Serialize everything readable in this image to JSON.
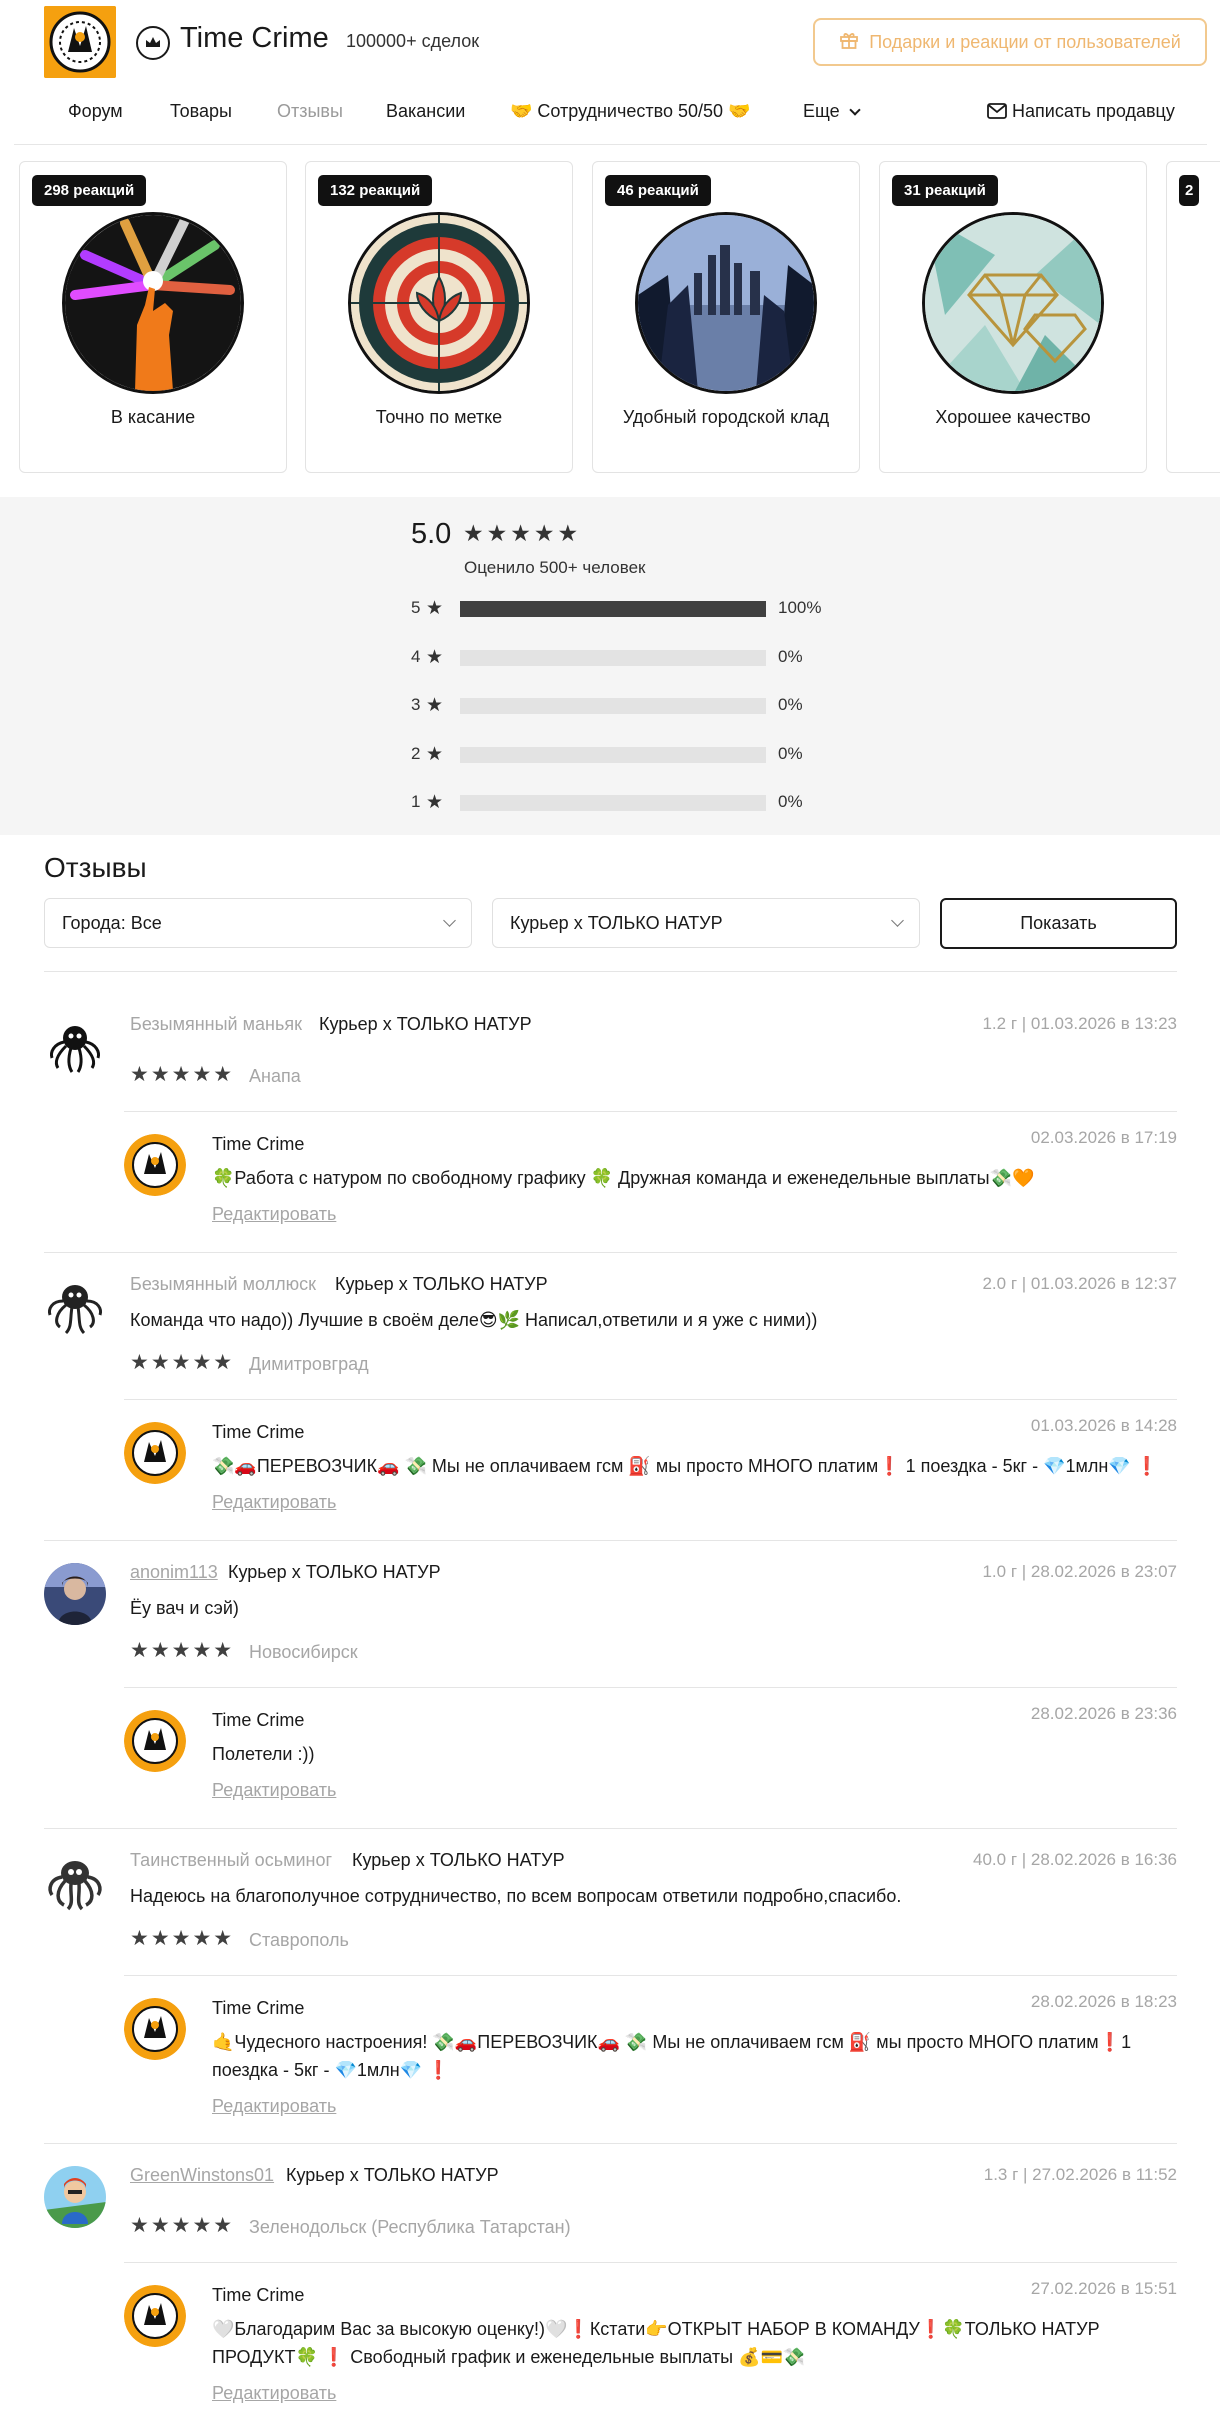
{
  "header": {
    "shop_title": "Time Crime",
    "deals": "100000+ сделок",
    "gifts_button": "Подарки и реакции от пользователей"
  },
  "nav": {
    "items": [
      "Форум",
      "Товары",
      "Отзывы",
      "Вакансии",
      "🤝 Сотрудничество 50/50 🤝",
      "Еще"
    ],
    "write_seller": "Написать продавцу"
  },
  "gift_cards": [
    {
      "badge": "298 реакций",
      "label": "В касание"
    },
    {
      "badge": "132 реакций",
      "label": "Точно по метке"
    },
    {
      "badge": "46 реакций",
      "label": "Удобный городской клад"
    },
    {
      "badge": "31 реакций",
      "label": "Хорошее качество"
    },
    {
      "badge": "2",
      "label": ""
    }
  ],
  "rating": {
    "average": "5.0",
    "stars": "★★★★★",
    "rated_by": "Оценило 500+ человек",
    "rows": [
      {
        "stars": "5",
        "percent_label": "100%",
        "fraction": 1.0
      },
      {
        "stars": "4",
        "percent_label": "0%",
        "fraction": 0
      },
      {
        "stars": "3",
        "percent_label": "0%",
        "fraction": 0
      },
      {
        "stars": "2",
        "percent_label": "0%",
        "fraction": 0
      },
      {
        "stars": "1",
        "percent_label": "0%",
        "fraction": 0
      }
    ]
  },
  "reviews_section": {
    "title": "Отзывы",
    "city_filter": "Города: Все",
    "product_filter": "Курьер x ТОЛЬКО НАТУР",
    "show_button": "Показать"
  },
  "reviews": [
    {
      "author": "Безымянный маньяк",
      "product": "Курьер x ТОЛЬКО НАТУР",
      "date": "1.2 г | 01.03.2026 в 13:23",
      "text": "",
      "stars": "★★★★★",
      "city": "Анапа",
      "reply": {
        "seller": "Time Crime",
        "date": "02.03.2026 в 17:19",
        "text": "🍀Работа с натуром по свободному графику 🍀 Дружная команда и еженедельные выплаты💸🧡",
        "edit": "Редактировать"
      }
    },
    {
      "author": "Безымянный моллюск",
      "product": "Курьер x ТОЛЬКО НАТУР",
      "date": "2.0 г | 01.03.2026 в 12:37",
      "text": "Команда что надо)) Лучшие в своём деле😎🌿 Написал,ответили и я уже с ними))",
      "stars": "★★★★★",
      "city": "Димитровград",
      "reply": {
        "seller": "Time Crime",
        "date": "01.03.2026 в 14:28",
        "text": "💸🚗ПЕРЕВОЗЧИК🚗 💸 Мы не оплачиваем гсм ⛽ мы просто МНОГО платим❗ 1 поездка - 5кг - 💎1млн💎 ❗",
        "edit": "Редактировать"
      }
    },
    {
      "author": "anonim113",
      "product": "Курьер x ТОЛЬКО НАТУР",
      "date": "1.0 г | 28.02.2026 в 23:07",
      "text": "Ёу вач и сэй)",
      "stars": "★★★★★",
      "city": "Новосибирск",
      "reply": {
        "seller": "Time Crime",
        "date": "28.02.2026 в 23:36",
        "text": "Полетели :))",
        "edit": "Редактировать"
      }
    },
    {
      "author": "Таинственный осьминог",
      "product": "Курьер x ТОЛЬКО НАТУР",
      "date": "40.0 г | 28.02.2026 в 16:36",
      "text": "Надеюсь на благополучное сотрудничество, по всем вопросам ответили подробно,спасибо.",
      "stars": "★★★★★",
      "city": "Ставрополь",
      "reply": {
        "seller": "Time Crime",
        "date": "28.02.2026 в 18:23",
        "text": "🤙Чудесного настроения! 💸🚗ПЕРЕВОЗЧИК🚗 💸 Мы не оплачиваем гсм ⛽ мы просто МНОГО платим❗1 поездка - 5кг - 💎1млн💎 ❗",
        "edit": "Редактировать"
      }
    },
    {
      "author": "GreenWinstons01",
      "product": "Курьер x ТОЛЬКО НАТУР",
      "date": "1.3 г | 27.02.2026 в 11:52",
      "text": "",
      "stars": "★★★★★",
      "city": "Зеленодольск (Республика Татарстан)",
      "reply": {
        "seller": "Time Crime",
        "date": "27.02.2026 в 15:51",
        "text": "🤍Благодарим Вас за высокую оценку!)🤍❗Кстати👉ОТКРЫТ НАБОР В КОМАНДУ❗🍀ТОЛЬКО НАТУР ПРОДУКТ🍀 ❗ Свободный график и еженедельные выплаты 💰💳💸",
        "edit": "Редактировать"
      }
    }
  ],
  "colors": {
    "accent_orange": "#f5a00f",
    "gift_border": "#f2c98e",
    "muted_text": "#a6a6a6",
    "bar_fill": "#404040"
  }
}
